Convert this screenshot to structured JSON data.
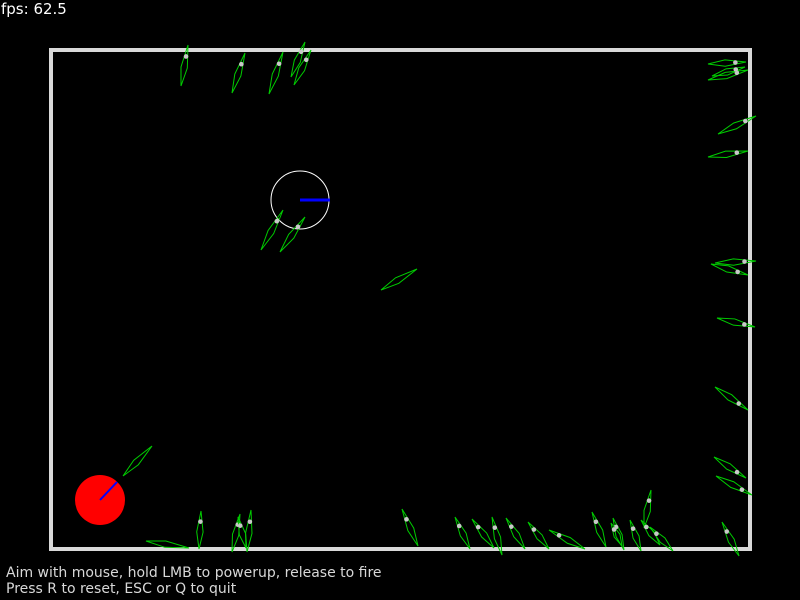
{
  "hud": {
    "fps_label": "fps: 62.5"
  },
  "instructions": {
    "line1": "Aim with mouse, hold LMB to powerup, release to fire",
    "line2": "Press R to reset, ESC or Q to quit"
  },
  "colors": {
    "background": "#000000",
    "wall": "#d9d9d9",
    "player": "#ff0000",
    "aim": "#0000ff",
    "arrow": "#00cc00",
    "dot": "#c8c8c8",
    "target_ring": "#ffffff"
  }
}
